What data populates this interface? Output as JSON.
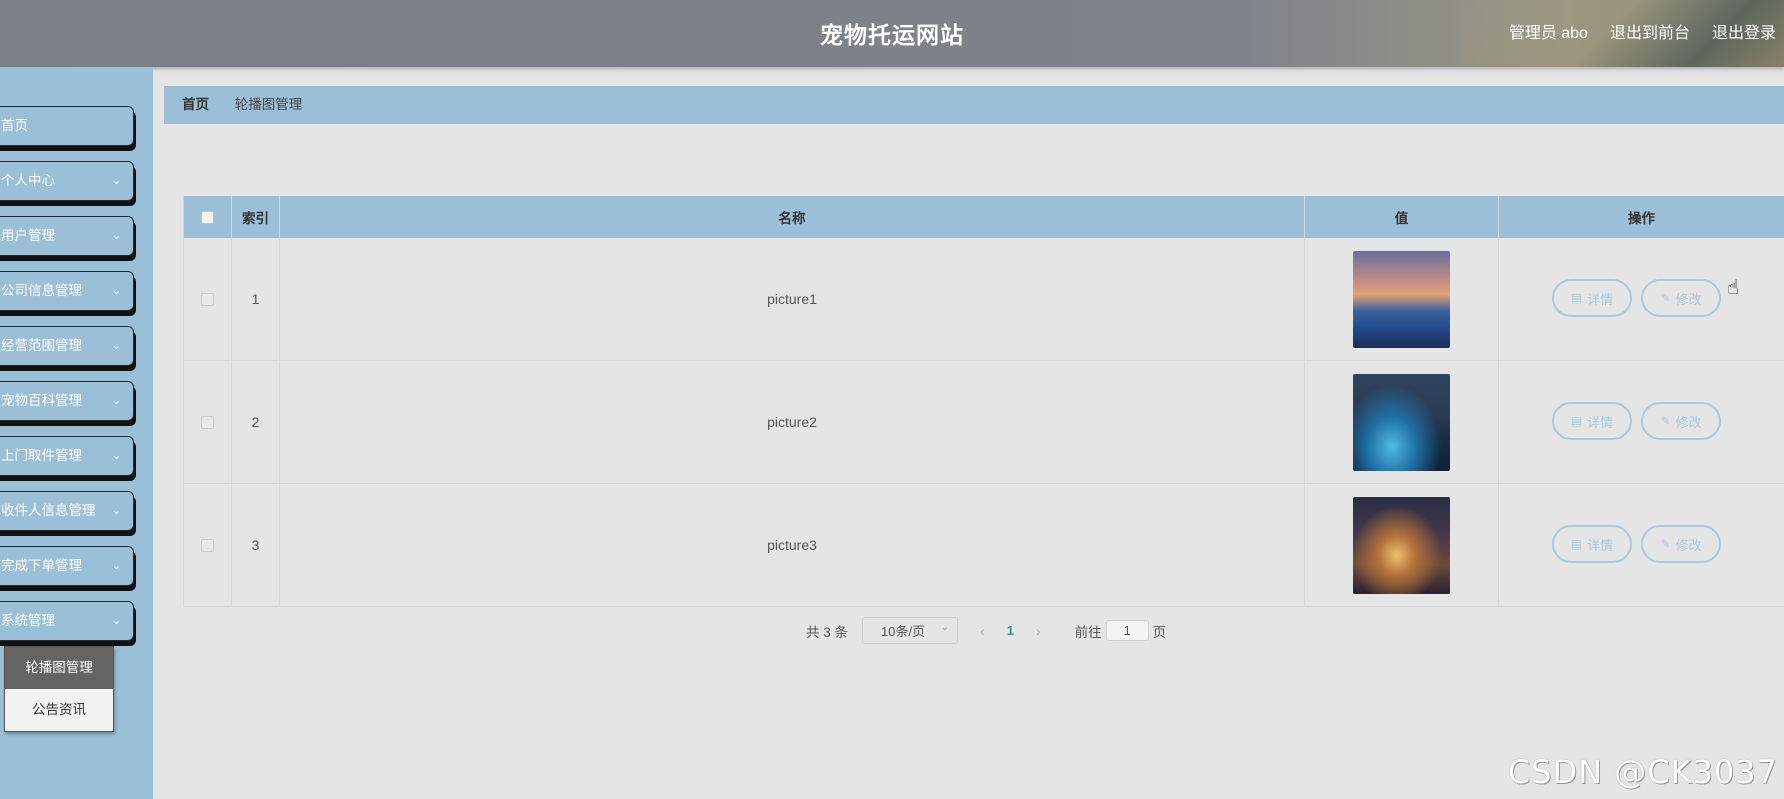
{
  "header": {
    "title": "宠物托运网站",
    "admin_label": "管理员 abo",
    "to_front_label": "退出到前台",
    "logout_label": "退出登录"
  },
  "sidebar": {
    "items": [
      {
        "label": "首页",
        "has_children": false
      },
      {
        "label": "个人中心",
        "has_children": true
      },
      {
        "label": "用户管理",
        "has_children": true
      },
      {
        "label": "公司信息管理",
        "has_children": true
      },
      {
        "label": "经营范围管理",
        "has_children": true
      },
      {
        "label": "宠物百科管理",
        "has_children": true
      },
      {
        "label": "上门取件管理",
        "has_children": true
      },
      {
        "label": "收件人信息管理",
        "has_children": true
      },
      {
        "label": "完成下单管理",
        "has_children": true
      },
      {
        "label": "系统管理",
        "has_children": true
      }
    ],
    "submenu": [
      {
        "label": "轮播图管理",
        "active": true
      },
      {
        "label": "公告资讯",
        "active": false
      }
    ]
  },
  "breadcrumb": {
    "home": "首页",
    "current": "轮播图管理"
  },
  "table": {
    "columns": [
      "索引",
      "名称",
      "值",
      "操作"
    ],
    "rows": [
      {
        "index": "1",
        "name": "picture1",
        "image": "city-skyline-sunset"
      },
      {
        "index": "2",
        "name": "picture2",
        "image": "bridge-night"
      },
      {
        "index": "3",
        "name": "picture3",
        "image": "city-night-lights"
      }
    ],
    "detail_label": "详情",
    "edit_label": "修改"
  },
  "pagination": {
    "total": "共 3 条",
    "page_size": "10条/页",
    "current_page": "1",
    "goto_prefix": "前往",
    "goto_value": "1",
    "goto_suffix": "页"
  },
  "watermark": "CSDN @CK3037",
  "colors": {
    "accent": "#9bbfd6",
    "button_border": "#a9c9dd",
    "active_page": "#2a9a8e"
  }
}
